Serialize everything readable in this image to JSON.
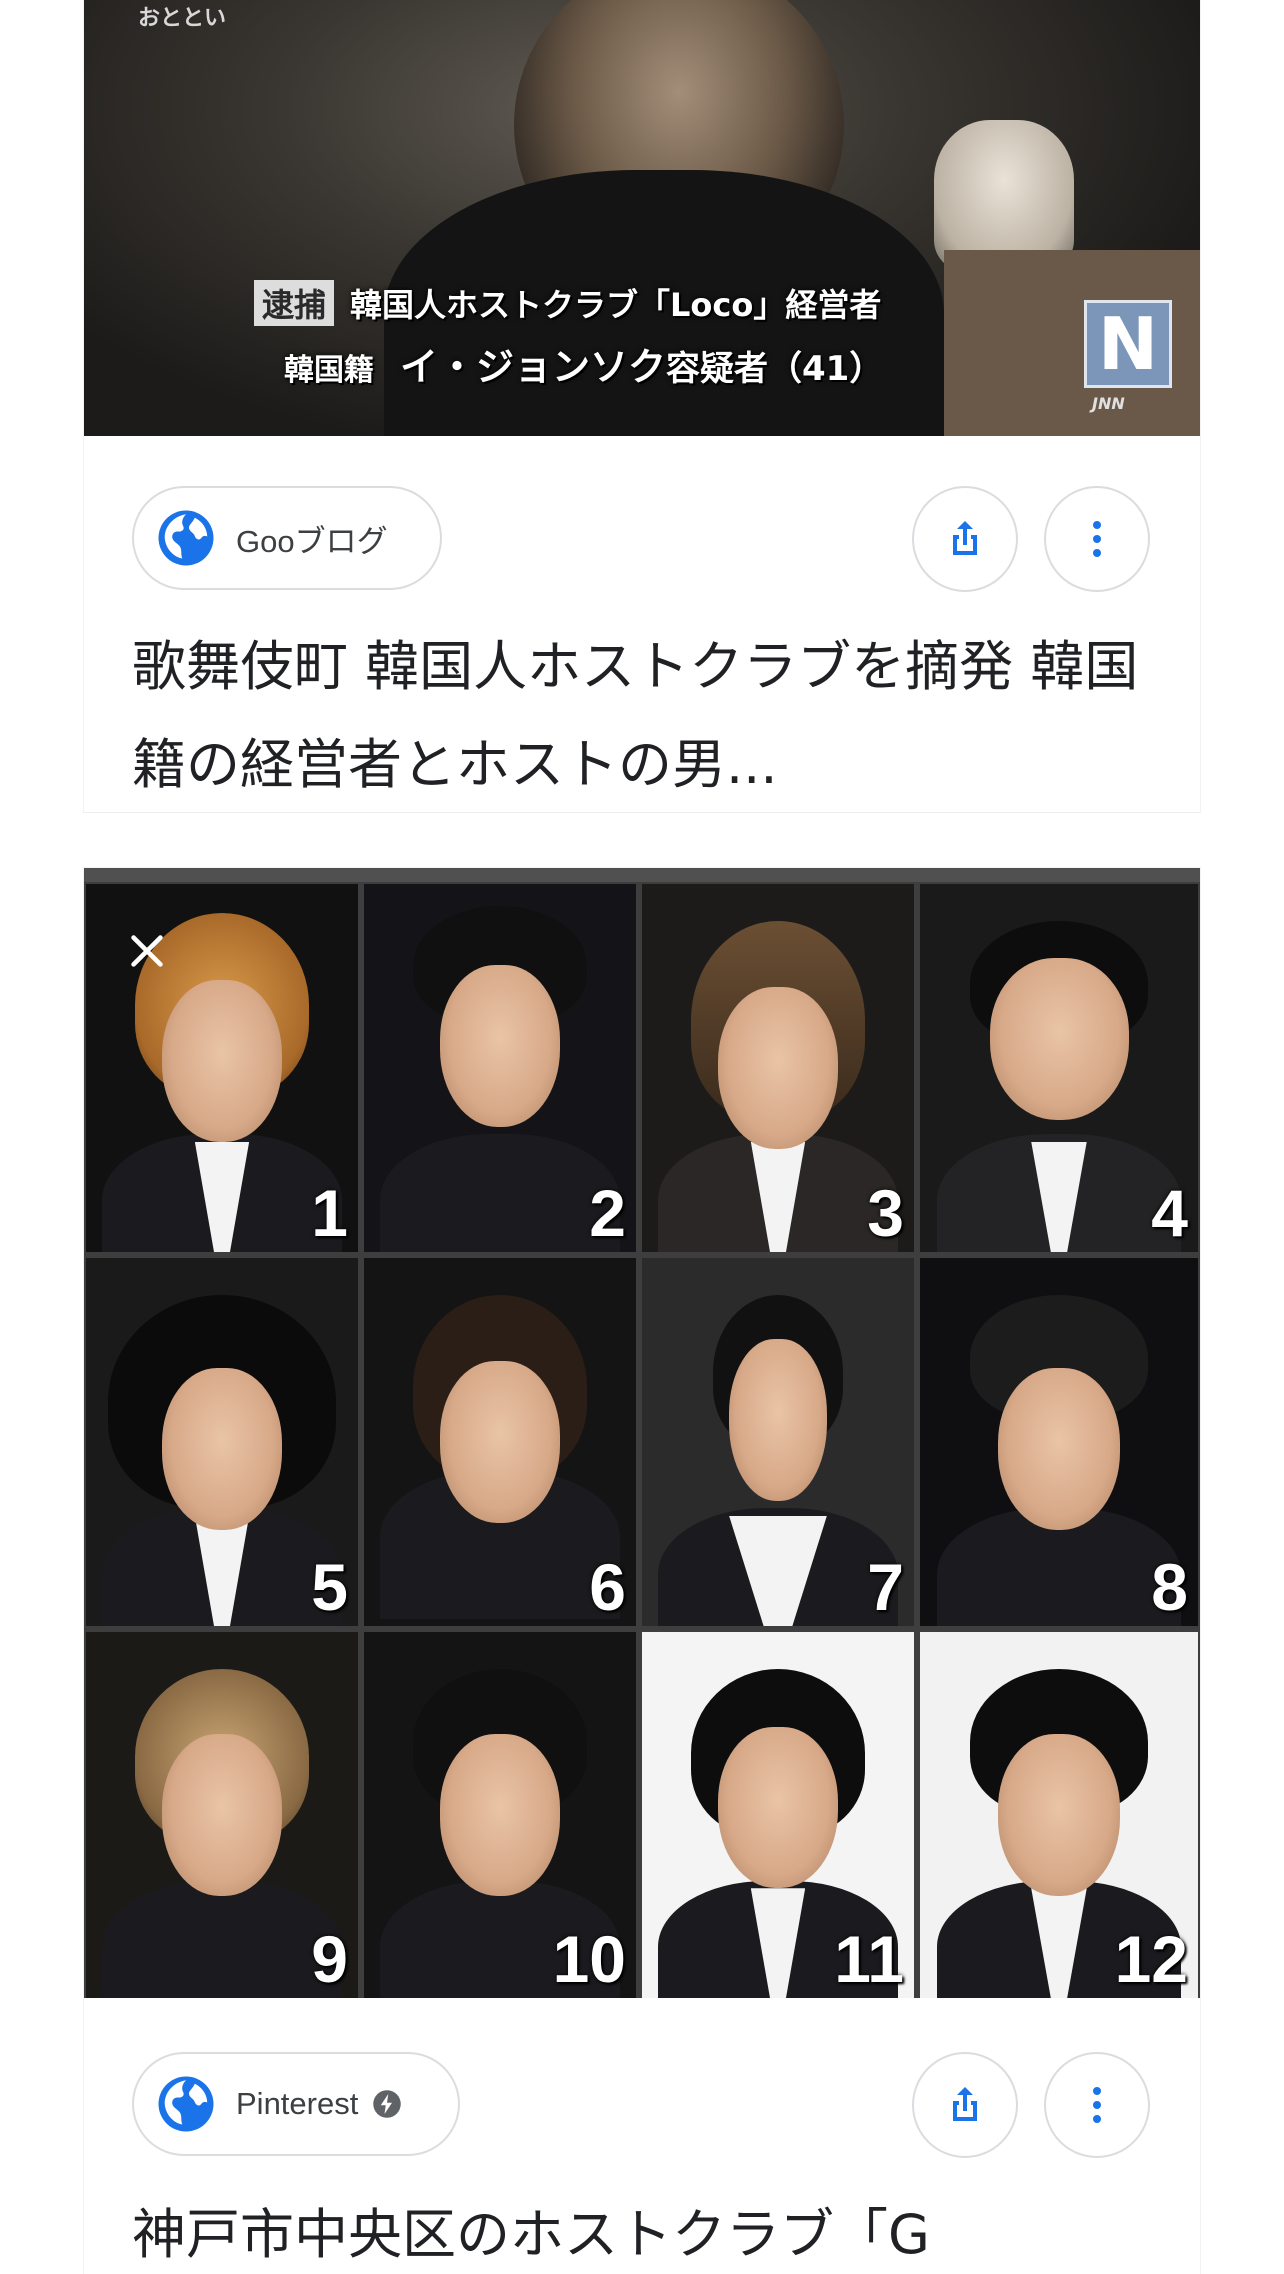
{
  "results": [
    {
      "image": {
        "top_label": "おととい",
        "caption_tag": "逮捕",
        "caption_line1": "韓国人ホストクラブ「Loco」経営者",
        "caption_line2_prefix": "韓国籍",
        "caption_line2_name": "イ・ジョンソク",
        "caption_line2_suffix": "容疑者（41）",
        "logo_letter": "N",
        "logo_text": "JNN"
      },
      "source": "Gooブログ",
      "title": "歌舞伎町 韓国人ホストクラブを摘発 韓国籍の経営者とホストの男..."
    },
    {
      "image": {
        "numbers": [
          "1",
          "2",
          "3",
          "4",
          "5",
          "6",
          "7",
          "8",
          "9",
          "10",
          "11",
          "12"
        ]
      },
      "source": "Pinterest",
      "title": "神戸市中央区のホストクラブ「G"
    }
  ],
  "colors": {
    "accent_blue": "#1a73e8",
    "icon_gray": "#5f6368",
    "text": "#202124",
    "border": "#dadce0"
  },
  "icons": {
    "source": "globe-icon",
    "share": "share-icon",
    "more": "more-vert-icon",
    "amp": "amp-lightning-icon",
    "close": "close-icon"
  }
}
